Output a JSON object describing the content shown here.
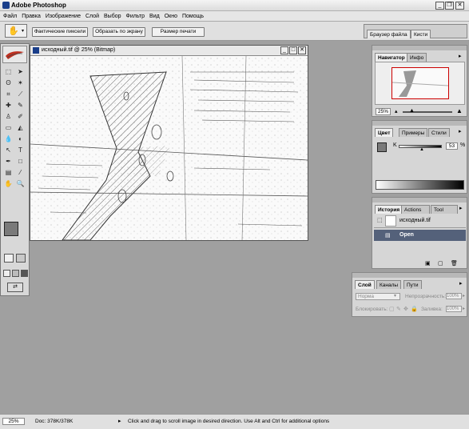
{
  "window": {
    "title": "Adobe Photoshop"
  },
  "menu": [
    "Файл",
    "Правка",
    "Изображение",
    "Слой",
    "Выбор",
    "Фильтр",
    "Вид",
    "Окно",
    "Помощь"
  ],
  "options": {
    "buttons": [
      "Фактические пиксели",
      "Образать по экрану",
      "Размер печати"
    ]
  },
  "palette_well": {
    "tabs": [
      "Браузер файла",
      "Кисти"
    ]
  },
  "document": {
    "title": "исходный.tif @ 25% (Bitmap)"
  },
  "navigator": {
    "tabs": [
      "Навигатор",
      "Инфо"
    ],
    "zoom": "25%"
  },
  "color": {
    "tabs": [
      "Цвет",
      "Примеры",
      "Стили"
    ],
    "channel": "K",
    "value": "53",
    "unit": "%"
  },
  "history": {
    "tabs": [
      "История",
      "Actions",
      "Tool Presets"
    ],
    "file": "исходный.tif",
    "state": "Open"
  },
  "layers": {
    "tabs": [
      "Слой",
      "Каналы",
      "Пути"
    ],
    "blend": "Норма",
    "opacity_label": "Непрозрачность:",
    "opacity": "100%",
    "lock_label": "Блокировать:",
    "fill_label": "Заливка:",
    "fill": "100%"
  },
  "status": {
    "zoom": "25%",
    "doc": "Doc: 378K/378K",
    "hint": "Click and drag to scroll image in desired direction.  Use Alt and Ctrl for additional options"
  }
}
